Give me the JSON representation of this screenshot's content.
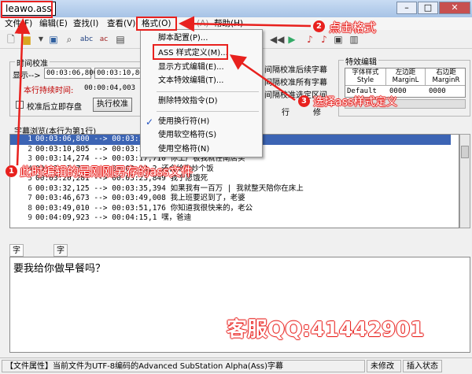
{
  "window": {
    "title": "leawo.ass"
  },
  "menubar": {
    "items": [
      "文件(F)",
      "编辑(E)",
      "查找(I)",
      "查看(V)",
      "格式(O)",
      "(A)",
      "帮助(H)"
    ]
  },
  "toolbar": {
    "abc1": "abc",
    "abc2": "ac"
  },
  "timing": {
    "title": "时间校准",
    "display_label": "显示-->",
    "start_time": "00:03:06,800",
    "end_time": "00:03:10,800",
    "duration_label": "本行持续时间:",
    "duration_value": "00:00:04,003",
    "save_checkbox_label": "校准后立即存盘",
    "calibrate_button": "执行校准",
    "opt1": "间隔校准后续字幕",
    "opt2": "间隔校准所有字幕",
    "opt3": "间隔校准选定区间",
    "row_trunc": "行",
    "mod_trunc": "修"
  },
  "effects": {
    "title": "特效编辑",
    "headers": [
      "字体样式\nStyle",
      "左边距\nMarginL",
      "右边距\nMarginR"
    ],
    "row": [
      "Default",
      "0000",
      "0000"
    ]
  },
  "preview": {
    "title": "字幕浏览(本行为第1行)",
    "rows": [
      {
        "n": "1",
        "text": "00:03:06,800 --> 00:03:10,8"
      },
      {
        "n": "2",
        "text": "00:03:10,805 --> 00:03:14,2"
      },
      {
        "n": "3",
        "text": "00:03:14,274 --> 00:03:17,710 你工厂板我就任南店买"
      },
      {
        "n": "4",
        "text": "00:03:17,777 --> 00:03:20,2  还会给你炒个饭"
      },
      {
        "n": "5",
        "text": "00:03:20,281 --> 00:03:23,849 我宁愿饿死"
      },
      {
        "n": "6",
        "text": "00:03:32,125 --> 00:03:35,394 如果我有一百万 | 我就整天陪你在床上"
      },
      {
        "n": "7",
        "text": "00:03:46,673 --> 00:03:49,008 我上班要迟到了，老婆"
      },
      {
        "n": "8",
        "text": "00:03:49,010 --> 00:03:51,176 你知道我很快来的，老公"
      },
      {
        "n": "9",
        "text": "00:04:09,923 --> 00:04:15,1 嘿，爸迪"
      }
    ]
  },
  "format_menu": {
    "items": [
      "脚本配置(P)...",
      "ASS 样式定义(M)...",
      "显示方式编辑(E)...",
      "文本特效编辑(T)...",
      "删除特效指令(D)",
      "使用换行符(H)",
      "使用软空格符(S)",
      "使用空格符(N)"
    ],
    "checked_index": 5
  },
  "annotations": {
    "a1_num": "1",
    "a1_text": "此时编辑的是刚刚另存的ass文件",
    "a2_num": "2",
    "a2_text": "点击格式",
    "a3_num": "3",
    "a3_text": "选择ass样式定义",
    "service": "客服QQ:41442901"
  },
  "editor_tabs": [
    "字幕编辑",
    "字幕预览"
  ],
  "editor_text": "要我给你做早餐吗？",
  "status": {
    "main": "【文件属性】当前文件为UTF-8编码的Advanced SubStation Alpha(Ass)字幕",
    "modified": "未修改",
    "insert": "插入状态"
  },
  "colors": {
    "annotation_red": "#e8211e",
    "selection_blue": "#3c64b4"
  }
}
